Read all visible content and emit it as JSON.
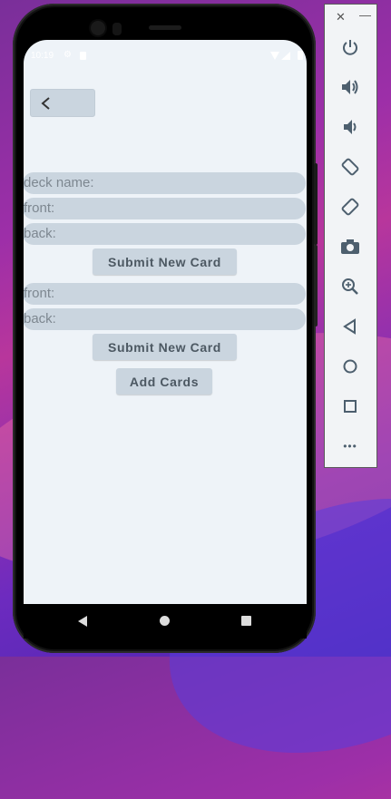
{
  "status_bar": {
    "time": "10:19"
  },
  "form": {
    "deck_name_label": "deck name:",
    "card1_front_label": "front:",
    "card1_back_label": "back:",
    "submit1_label": "Submit New Card",
    "card2_front_label": "front:",
    "card2_back_label": "back:",
    "submit2_label": "Submit New Card",
    "add_cards_label": "Add Cards"
  },
  "emulator_panel": {
    "close_glyph": "✕",
    "minimize_glyph": "—",
    "buttons": [
      "power-icon",
      "volume-up-icon",
      "volume-down-icon",
      "rotate-left-icon",
      "rotate-right-icon",
      "camera-icon",
      "zoom-icon",
      "back-icon",
      "home-icon",
      "overview-icon",
      "more-icon"
    ],
    "more_glyph": "•••"
  },
  "colors": {
    "screen_bg": "#eef3f8",
    "field_bg": "#cad5df",
    "button_text": "#4c5862"
  }
}
